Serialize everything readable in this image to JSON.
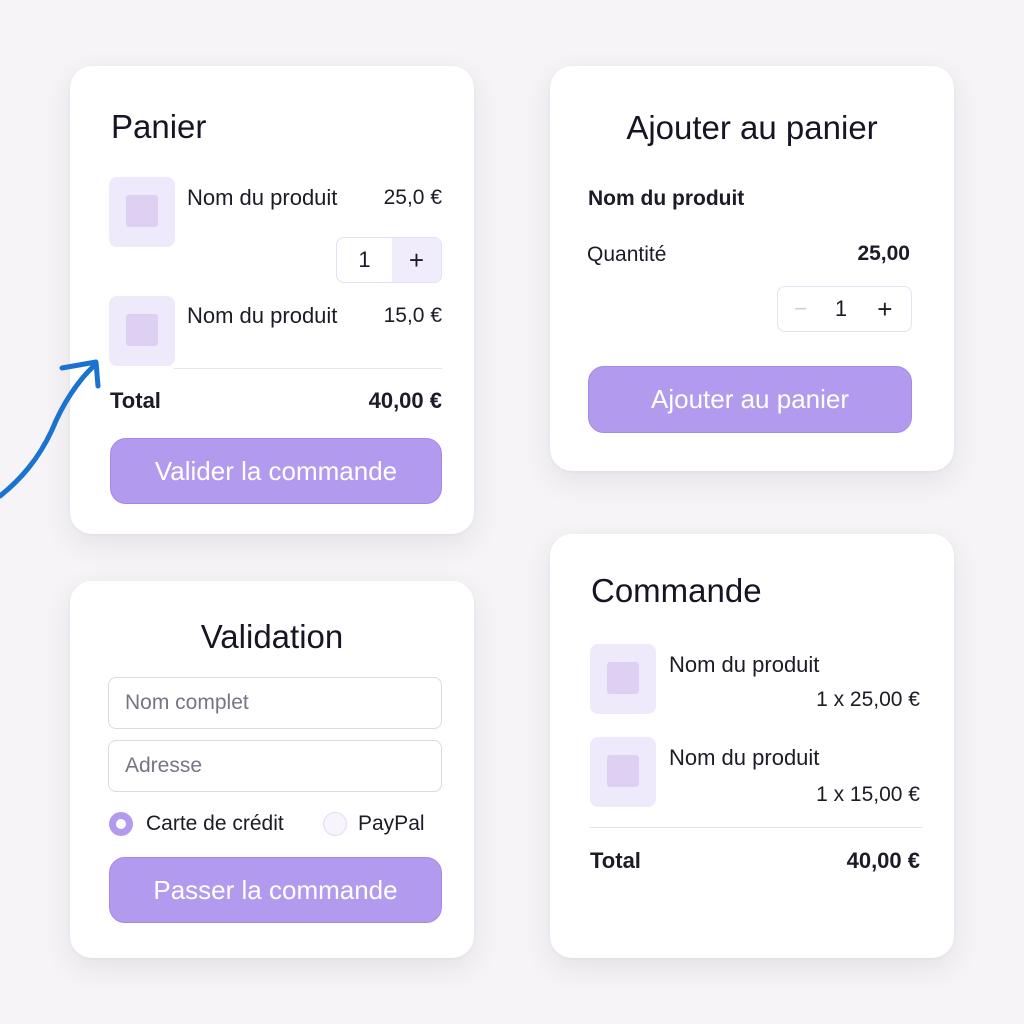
{
  "panier": {
    "title": "Panier",
    "items": [
      {
        "name": "Nom du produit",
        "price": "25,0 €",
        "quantity": "1",
        "plus": "+"
      },
      {
        "name": "Nom du produit",
        "price": "15,0 €"
      }
    ],
    "total_label": "Total",
    "total_value": "40,00 €",
    "button_label": "Valider la commande"
  },
  "ajouter": {
    "title": "Ajouter au panier",
    "product_name": "Nom du produit",
    "quantity_label": "Quantité",
    "price": "25,00",
    "minus": "−",
    "quantity": "1",
    "plus": "+",
    "button_label": "Ajouter au panier"
  },
  "validation": {
    "title": "Validation",
    "name_placeholder": "Nom complet",
    "address_placeholder": "Adresse",
    "payment_options": [
      {
        "label": "Carte de crédit",
        "selected": true
      },
      {
        "label": "PayPal",
        "selected": false
      }
    ],
    "button_label": "Passer la commande"
  },
  "commande": {
    "title": "Commande",
    "items": [
      {
        "name": "Nom du produit",
        "detail": "1 x 25,00 €"
      },
      {
        "name": "Nom du produit",
        "detail": "1 x 15,00 €"
      }
    ],
    "total_label": "Total",
    "total_value": "40,00 €"
  },
  "colors": {
    "accent": "#b29bef",
    "accent_border": "#a489e8",
    "thumb_bg": "#efeafb",
    "thumb_inner": "#ddd0f3",
    "annotation_arrow": "#1a73d1"
  },
  "icons": {
    "annotation": "arrow-annotation-icon",
    "product": "product-image-placeholder-icon"
  }
}
